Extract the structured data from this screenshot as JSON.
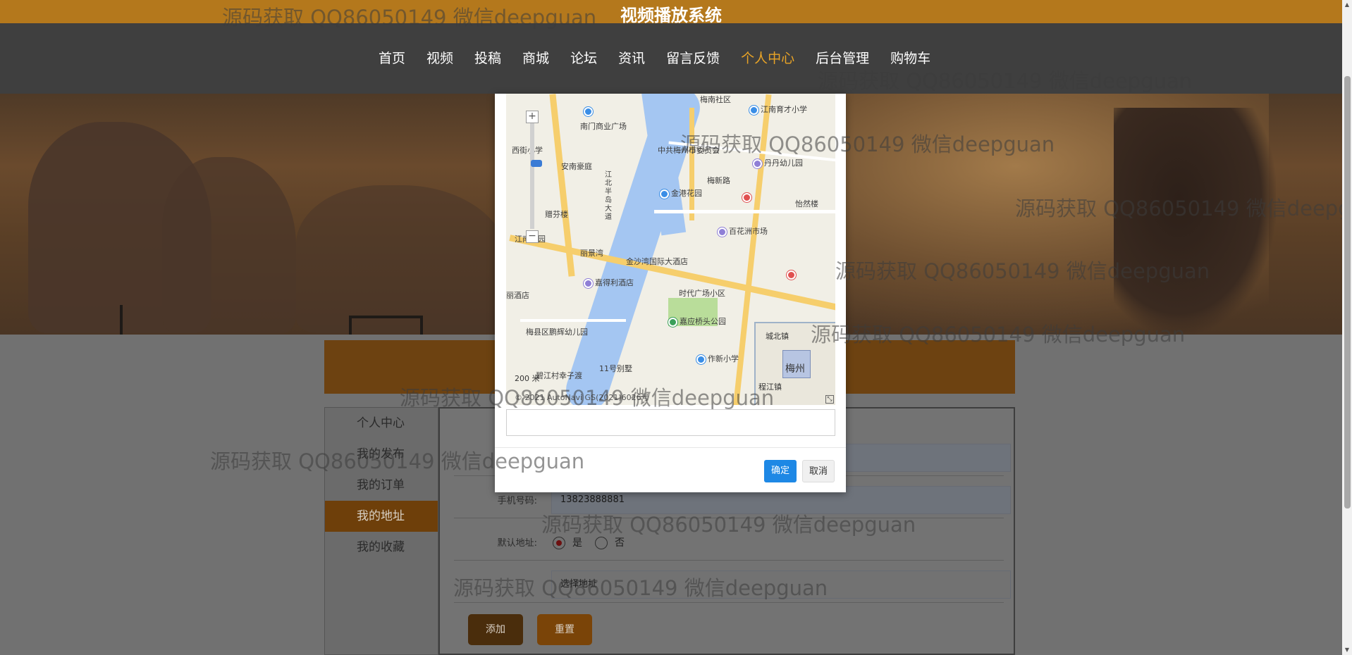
{
  "site": {
    "title": "视频播放系统"
  },
  "nav": {
    "items": [
      "首页",
      "视频",
      "投稿",
      "商城",
      "论坛",
      "资讯",
      "留言反馈",
      "个人中心",
      "后台管理",
      "购物车"
    ],
    "active_index": 7
  },
  "sidebar": {
    "items": [
      "个人中心",
      "我的发布",
      "我的订单",
      "我的地址",
      "我的收藏"
    ],
    "active_index": 3
  },
  "form": {
    "phone_label": "手机号码:",
    "phone_value": "13823888881",
    "default_label": "默认地址:",
    "default_yes": "是",
    "default_no": "否",
    "address_placeholder": "选择地址",
    "add_button": "添加",
    "reset_button": "重置"
  },
  "modal": {
    "ok_button": "确定",
    "cancel_button": "取消",
    "map": {
      "scale": "200 米",
      "copyright": "© 2021 AutoNavi GS(2021)6026号",
      "overview_label": "梅州",
      "overview_town_1": "城北镇",
      "overview_town_2": "程江镇",
      "pois": [
        "梅南社区",
        "江南育才小学",
        "南门商业广场",
        "丹丹幼儿园",
        "中共梅州市委员会",
        "安南豪庭",
        "梅新路",
        "金港花园",
        "怡然楼",
        "赠芬楼",
        "江南花园",
        "丽景湾",
        "百花洲市场",
        "金沙湾国际大酒店",
        "嘉得利酒店",
        "时代广场小区",
        "嘉应桥头公园",
        "梅县区鹏辉幼儿园",
        "11号别墅",
        "作新小学",
        "碧江村幸子渡",
        "西街小学",
        "丽酒店",
        "江北半岛大道"
      ]
    }
  },
  "watermark": "源码获取 QQ86050149 微信deepguan",
  "colors": {
    "brand": "#b4781c",
    "active_nav": "#e8a326",
    "primary_button": "#1e88e5"
  }
}
